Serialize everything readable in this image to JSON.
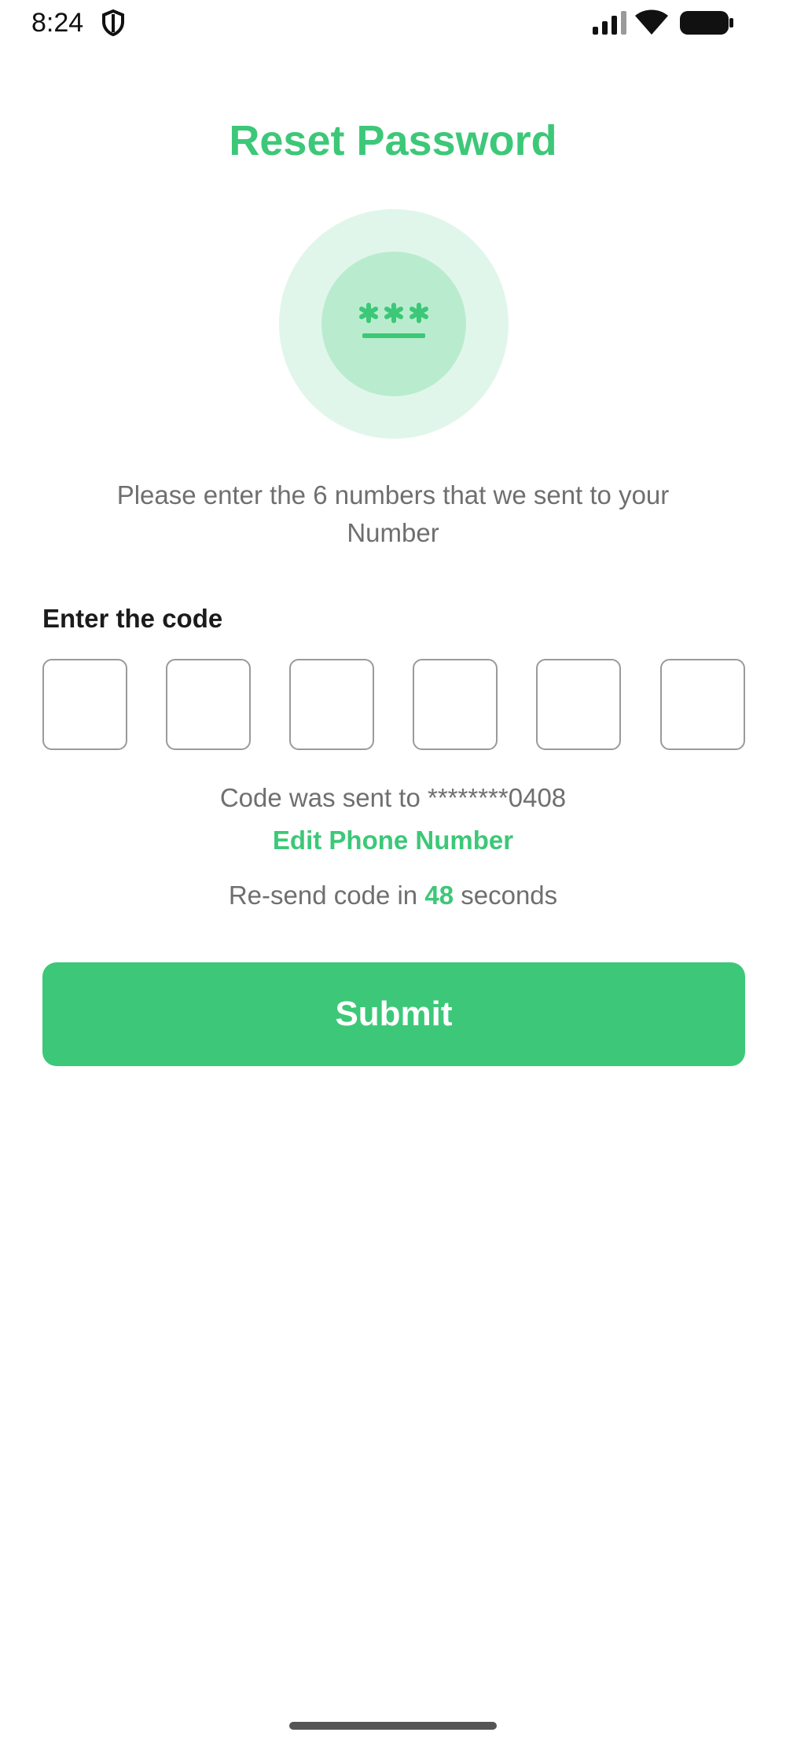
{
  "status_bar": {
    "time": "8:24",
    "icons": [
      "shield-icon",
      "signal-icon",
      "wifi-icon",
      "battery-icon"
    ]
  },
  "page": {
    "title": "Reset Password",
    "illustration_icon": "password-icon",
    "instruction": "Please enter the 6 numbers that we sent to your Number",
    "code_label": "Enter the code",
    "code_digits": [
      "",
      "",
      "",
      "",
      "",
      ""
    ],
    "sent_to_prefix": "Code was sent to",
    "masked_number": "********0408",
    "edit_phone_label": "Edit Phone Number",
    "resend_prefix": "Re-send code in",
    "resend_count": "48",
    "resend_suffix": "seconds",
    "submit_label": "Submit"
  },
  "colors": {
    "accent": "#3cc878",
    "accent_light": "#e1f6ea",
    "accent_mid": "#b9ecce",
    "muted_text": "#6f6f6f"
  }
}
